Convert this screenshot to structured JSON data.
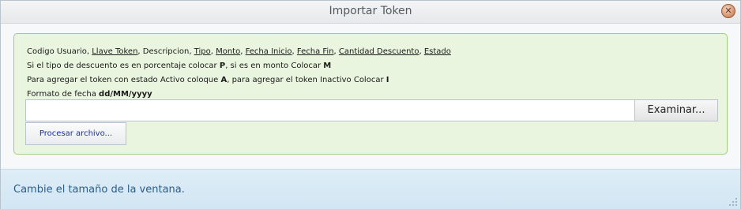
{
  "window": {
    "title": "Importar Token",
    "close_glyph": "✕"
  },
  "info": {
    "line1": {
      "items": [
        {
          "text": "Codigo Usuario",
          "underlined": false
        },
        {
          "text": "Llave Token",
          "underlined": true
        },
        {
          "text": "Descripcion",
          "underlined": false
        },
        {
          "text": "Tipo",
          "underlined": true
        },
        {
          "text": "Monto",
          "underlined": true
        },
        {
          "text": "Fecha Inicio",
          "underlined": true
        },
        {
          "text": "Fecha Fin",
          "underlined": true
        },
        {
          "text": "Cantidad Descuento",
          "underlined": true
        },
        {
          "text": "Estado",
          "underlined": true
        }
      ],
      "separator": ", "
    },
    "line2": {
      "prefix": "Si el tipo de descuento es en porcentaje colocar ",
      "bold1": "P",
      "middle": ", si es en monto Colocar ",
      "bold2": "M"
    },
    "line3": {
      "prefix": "Para agregar el token con estado Activo coloque ",
      "bold1": "A",
      "middle": ", para agregar el token Inactivo Colocar ",
      "bold2": "I"
    },
    "line4": {
      "prefix": "Formato de fecha ",
      "bold": "dd/MM/yyyy"
    }
  },
  "file": {
    "value": "",
    "browse_label": "Examinar..."
  },
  "process_label": "Procesar archivo...",
  "status": {
    "text": "Cambie el tamaño de la ventana."
  },
  "icons": {
    "close": "close-icon",
    "resize": "resize-grip-icon"
  },
  "colors": {
    "panel_bg": "#eaf5df",
    "panel_border": "#9ecf78",
    "status_text": "#2a5c8a",
    "process_text": "#1b2d9b"
  }
}
